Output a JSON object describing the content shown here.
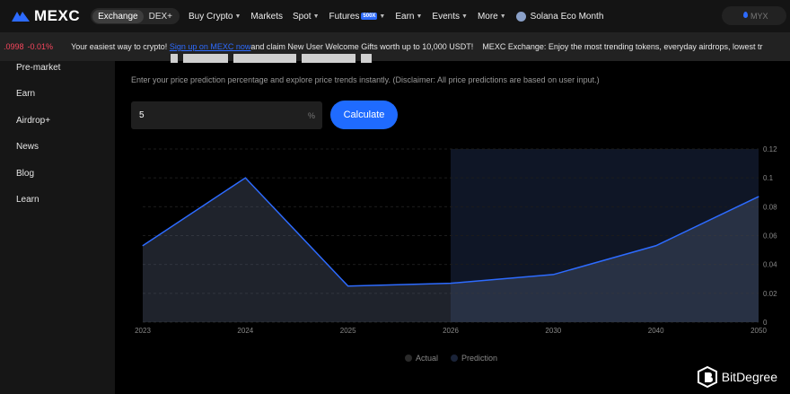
{
  "brand": {
    "name": "MEXC",
    "color": "#2d6bff"
  },
  "topnav": {
    "segments": [
      "Exchange",
      "DEX+"
    ],
    "items": [
      {
        "label": "Buy Crypto",
        "caret": true
      },
      {
        "label": "Markets",
        "caret": false
      },
      {
        "label": "Spot",
        "caret": true
      },
      {
        "label": "Futures",
        "caret": true,
        "badge": "500X"
      },
      {
        "label": "Earn",
        "caret": true
      },
      {
        "label": "Events",
        "caret": true
      },
      {
        "label": "More",
        "caret": true
      }
    ],
    "eco_label": "Solana Eco Month",
    "search_placeholder": "MYX"
  },
  "ticker": {
    "price": ".0998",
    "change": "-0.01%",
    "message_start": "Your easiest way to crypto! ",
    "message_link": "Sign up on MEXC now",
    "message_end": " and claim New User Welcome Gifts worth up to 10,000 USDT!",
    "message2": "MEXC Exchange: Enjoy the most trending tokens, everyday airdrops, lowest tr"
  },
  "sidebar": {
    "items": [
      "Pre-market",
      "Earn",
      "Airdrop+",
      "News",
      "Blog",
      "Learn"
    ]
  },
  "main": {
    "description": "Enter your price prediction percentage and explore price trends instantly. (Disclaimer: All price predictions are based on user input.)",
    "input_value": "5",
    "input_unit": "%",
    "calculate_label": "Calculate"
  },
  "chart_data": {
    "type": "area",
    "categories": [
      "2023",
      "2024",
      "2025",
      "2026",
      "2030",
      "2040",
      "2050"
    ],
    "values": [
      0.053,
      0.1,
      0.025,
      0.027,
      0.033,
      0.053,
      0.087
    ],
    "ylim": [
      0,
      0.12
    ],
    "y_ticks": [
      "0.12",
      "0.1",
      "0.08",
      "0.06",
      "0.04",
      "0.02",
      "0"
    ],
    "prediction_start": "2026",
    "series": [
      {
        "name": "Actual",
        "color": "#2a2a2a"
      },
      {
        "name": "Prediction",
        "color": "#1a2338"
      }
    ],
    "line_color": "#2d6bff",
    "grid": true
  },
  "watermark": {
    "text": "BitDegree"
  }
}
